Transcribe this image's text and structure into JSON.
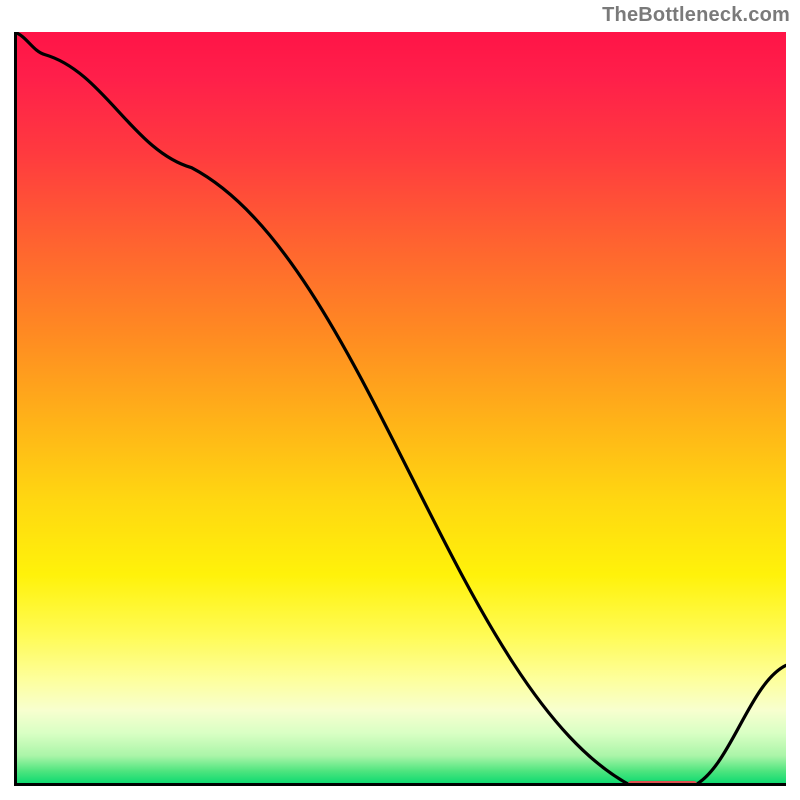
{
  "attribution": "TheBottleneck.com",
  "colors": {
    "gradient_top": "#ff1447",
    "gradient_bottom": "#00d76d",
    "curve": "#000000",
    "marker": "#e05050",
    "border": "#000000"
  },
  "chart_data": {
    "type": "line",
    "title": "",
    "xlabel": "",
    "ylabel": "",
    "xlim": [
      0,
      100
    ],
    "ylim": [
      0,
      100
    ],
    "x": [
      0,
      4,
      23,
      80,
      88,
      100
    ],
    "y": [
      100,
      97,
      82,
      0,
      0,
      16
    ],
    "min_region": {
      "x_start": 80,
      "x_end": 88,
      "y": 0
    },
    "annotations": []
  }
}
